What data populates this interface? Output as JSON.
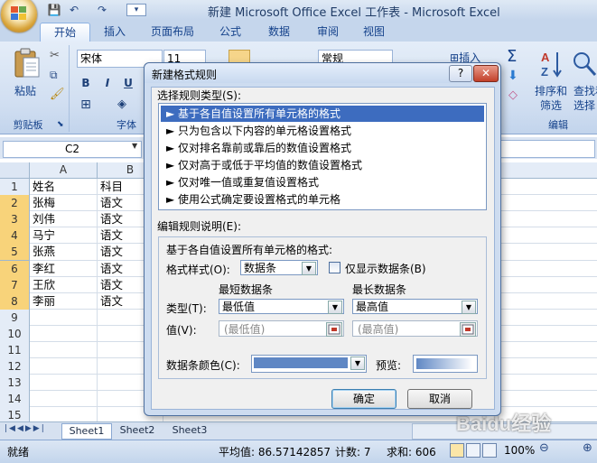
{
  "window": {
    "title": "新建 Microsoft Office Excel 工作表 - Microsoft Excel",
    "qat": [
      "💾",
      "↶",
      "↷",
      "▾"
    ]
  },
  "tabs": [
    "开始",
    "插入",
    "页面布局",
    "公式",
    "数据",
    "审阅",
    "视图"
  ],
  "ribbon": {
    "paste_label": "粘贴",
    "clipboard_label": "剪贴板",
    "font_name": "宋体",
    "font_size": "11",
    "font_group_label": "字体",
    "bold": "B",
    "italic": "I",
    "underline": "U",
    "number_format": "常规",
    "insert_label": "插入",
    "sort_label": "排序和",
    "filter_label": "筛选",
    "find_label": "查找和",
    "select_label": "选择",
    "edit_group_label": "编辑",
    "sum_symbol": "Σ"
  },
  "formula_bar": {
    "name_box": "C2"
  },
  "sheet": {
    "columns": [
      "A",
      "B"
    ],
    "rows": [
      "1",
      "2",
      "3",
      "4",
      "5",
      "6",
      "7",
      "8",
      "9",
      "10",
      "11",
      "12",
      "13",
      "14",
      "15"
    ],
    "cells": [
      [
        "姓名",
        "科目"
      ],
      [
        "张梅",
        "语文"
      ],
      [
        "刘伟",
        "语文"
      ],
      [
        "马宁",
        "语文"
      ],
      [
        "张燕",
        "语文"
      ],
      [
        "李红",
        "语文"
      ],
      [
        "王欣",
        "语文"
      ],
      [
        "李丽",
        "语文"
      ]
    ]
  },
  "sheet_tabs": [
    "Sheet1",
    "Sheet2",
    "Sheet3"
  ],
  "status": {
    "mode": "就绪",
    "average": "平均值: 86.57142857",
    "count": "计数: 7",
    "sum": "求和: 606",
    "zoom": "100%"
  },
  "dialog": {
    "title": "新建格式规则",
    "help_btn": "?",
    "close_btn": "✕",
    "select_rule_type_label": "选择规则类型(S):",
    "rule_types": [
      "► 基于各自值设置所有单元格的格式",
      "► 只为包含以下内容的单元格设置格式",
      "► 仅对排名靠前或靠后的数值设置格式",
      "► 仅对高于或低于平均值的数值设置格式",
      "► 仅对唯一值或重复值设置格式",
      "► 使用公式确定要设置格式的单元格"
    ],
    "edit_rule_label": "编辑规则说明(E):",
    "edit_rule_heading": "基于各自值设置所有单元格的格式:",
    "format_style_label": "格式样式(O):",
    "format_style_value": "数据条",
    "show_bar_only_label": "仅显示数据条(B)",
    "shortest_bar_label": "最短数据条",
    "longest_bar_label": "最长数据条",
    "type_label": "类型(T):",
    "min_type_value": "最低值",
    "max_type_value": "最高值",
    "value_label": "值(V):",
    "min_value_placeholder": "(最低值)",
    "max_value_placeholder": "(最高值)",
    "bar_color_label": "数据条颜色(C):",
    "bar_color": "#5f87c4",
    "preview_label": "预览:",
    "ok_label": "确定",
    "cancel_label": "取消"
  },
  "watermark": "Baidu经验"
}
